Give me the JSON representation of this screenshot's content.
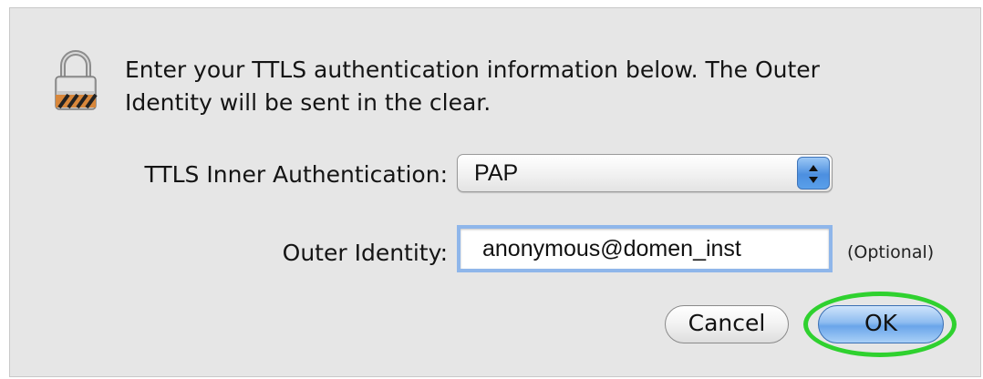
{
  "dialog": {
    "message": "Enter your TTLS authentication information below. The Outer Identity will be sent in the clear.",
    "icon": "lock-icon"
  },
  "form": {
    "inner_auth_label": "TTLS Inner Authentication:",
    "inner_auth_value": "PAP",
    "outer_identity_label": "Outer Identity:",
    "outer_identity_value": "anonymous@domen_inst",
    "optional_note": "(Optional)"
  },
  "buttons": {
    "cancel_label": "Cancel",
    "ok_label": "OK"
  },
  "colors": {
    "highlight": "#2fd12f",
    "accent": "#6aa5ea"
  }
}
